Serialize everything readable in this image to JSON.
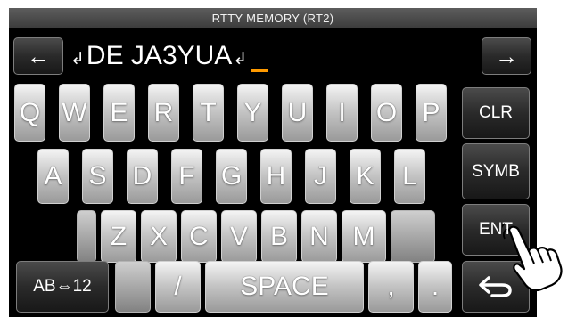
{
  "title": "RTTY MEMORY (RT2)",
  "nav": {
    "left_arrow": "←",
    "right_arrow": "→"
  },
  "entry": {
    "prefix_symbol": "↲",
    "text": "DE JA3YUA",
    "suffix_symbol": "↲"
  },
  "keyboard": {
    "row1": [
      "Q",
      "W",
      "E",
      "R",
      "T",
      "Y",
      "U",
      "I",
      "O",
      "P"
    ],
    "row2": [
      "A",
      "S",
      "D",
      "F",
      "G",
      "H",
      "J",
      "K",
      "L"
    ],
    "row3": [
      "Z",
      "X",
      "C",
      "V",
      "B",
      "N",
      "M"
    ],
    "row4": {
      "mode_label": "AB⇔12",
      "slash": "/",
      "space": "SPACE",
      "comma": ",",
      "period": "."
    }
  },
  "function_keys": {
    "clr": "CLR",
    "symb": "SYMB",
    "ent": "ENT"
  },
  "icons": {
    "back": "return-arrow-icon",
    "hand": "pointing-hand-icon"
  },
  "colors": {
    "cursor": "#ff9a00",
    "screen_bg": "#000000"
  }
}
